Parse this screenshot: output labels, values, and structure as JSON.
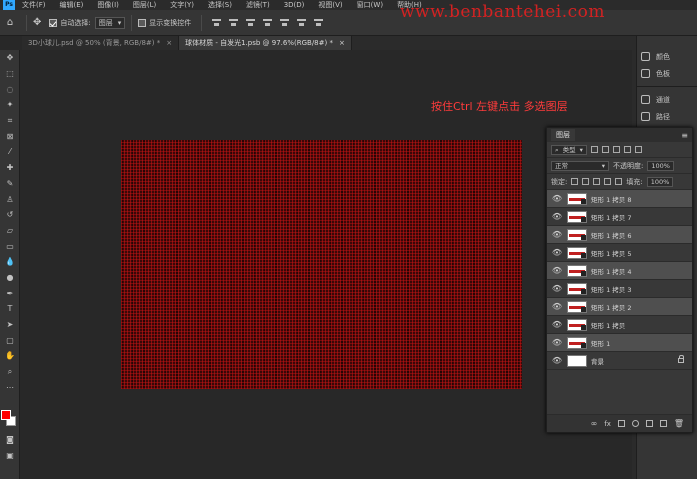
{
  "app": {
    "logo": "Ps"
  },
  "menu": [
    "文件(F)",
    "编辑(E)",
    "图像(I)",
    "图层(L)",
    "文字(Y)",
    "选择(S)",
    "滤镜(T)",
    "3D(D)",
    "视图(V)",
    "窗口(W)",
    "帮助(H)"
  ],
  "options": {
    "auto_select_label": "自动选择:",
    "auto_select_checked": true,
    "auto_select_target": "图层",
    "show_transform_label": "显示变换控件",
    "show_transform_checked": false
  },
  "watermark": "www.benbantehei.com",
  "tabs": [
    {
      "label": "3D小球儿.psd @ 50% (背景, RGB/8#) *",
      "active": false
    },
    {
      "label": "球体材质 - 自发光1.psb @ 97.6%(RGB/8#) *",
      "active": true
    }
  ],
  "hint_text": "按住Ctrl 左键点击 多选图层",
  "right_panels": [
    "颜色",
    "色板",
    "通道",
    "路径"
  ],
  "layers_panel": {
    "tab": "图层",
    "filter_kind": "类型",
    "blend_mode": "正常",
    "opacity_label": "不透明度:",
    "opacity_value": "100%",
    "lock_label": "锁定:",
    "fill_label": "填充:",
    "fill_value": "100%",
    "layers": [
      {
        "name": "矩形 1 拷贝 8",
        "selected": true
      },
      {
        "name": "矩形 1 拷贝 7",
        "selected": false
      },
      {
        "name": "矩形 1 拷贝 6",
        "selected": true
      },
      {
        "name": "矩形 1 拷贝 5",
        "selected": false
      },
      {
        "name": "矩形 1 拷贝 4",
        "selected": true
      },
      {
        "name": "矩形 1 拷贝 3",
        "selected": false
      },
      {
        "name": "矩形 1 拷贝 2",
        "selected": true
      },
      {
        "name": "矩形 1 拷贝",
        "selected": false
      },
      {
        "name": "矩形 1",
        "selected": true
      }
    ],
    "background_layer": "背景"
  },
  "colors": {
    "foreground": "#ff0000",
    "background": "#ffffff",
    "accent_text": "#ff3b3b"
  }
}
